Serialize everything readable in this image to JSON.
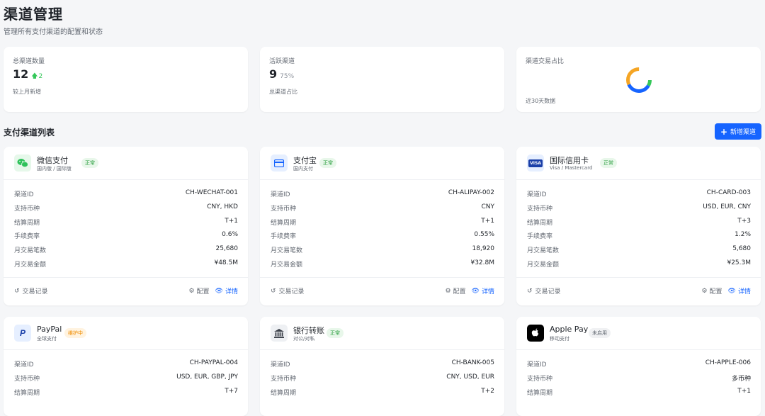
{
  "header": {
    "title": "渠道管理",
    "subtitle": "管理所有支付渠道的配置和状态"
  },
  "stats": {
    "total": {
      "label": "总渠道数量",
      "value": "12",
      "delta": "2",
      "note": "较上月新增"
    },
    "active": {
      "label": "活跃渠道",
      "value": "9",
      "pct": "75%",
      "note": "总渠道占比"
    },
    "share": {
      "label": "渠道交易占比",
      "note": "近30天数据",
      "donut_colors": [
        "#34c759",
        "#1664ff",
        "#f5a524"
      ]
    }
  },
  "section": {
    "title": "支付渠道列表",
    "add_label": "新增渠道"
  },
  "row_labels": {
    "id": "渠道ID",
    "currency": "支持币种",
    "settle": "结算周期",
    "fee": "手续费率",
    "count": "月交易笔数",
    "amount": "月交易金额"
  },
  "actions": {
    "records": "交易记录",
    "config": "配置",
    "detail": "详情"
  },
  "channels": [
    {
      "name": "微信支付",
      "sub": "国内版 / 国际版",
      "status": "正常",
      "icon": "wechat-icon",
      "id": "CH-WECHAT-001",
      "currency": "CNY, HKD",
      "settle": "T+1",
      "fee": "0.6%",
      "count": "25,680",
      "amount": "¥48.5M"
    },
    {
      "name": "支付宝",
      "sub": "国内支付",
      "status": "正常",
      "icon": "alipay-card-icon",
      "id": "CH-ALIPAY-002",
      "currency": "CNY",
      "settle": "T+1",
      "fee": "0.55%",
      "count": "18,920",
      "amount": "¥32.8M"
    },
    {
      "name": "国际信用卡",
      "sub": "Visa / Mastercard",
      "status": "正常",
      "icon": "visa-icon",
      "icon_text": "VISA",
      "id": "CH-CARD-003",
      "currency": "USD, EUR, CNY",
      "settle": "T+3",
      "fee": "1.2%",
      "count": "5,680",
      "amount": "¥25.3M"
    },
    {
      "name": "PayPal",
      "sub": "全球支付",
      "status": "维护中",
      "icon": "paypal-icon",
      "id": "CH-PAYPAL-004",
      "currency": "USD, EUR, GBP, JPY",
      "settle": "T+7"
    },
    {
      "name": "银行转账",
      "sub": "对公/对私",
      "status": "正常",
      "icon": "bank-icon",
      "id": "CH-BANK-005",
      "currency": "CNY, USD, EUR",
      "settle": "T+2"
    },
    {
      "name": "Apple Pay",
      "sub": "移动支付",
      "status": "未启用",
      "icon": "apple-icon",
      "id": "CH-APPLE-006",
      "currency": "多币种",
      "settle": "T+1"
    }
  ]
}
